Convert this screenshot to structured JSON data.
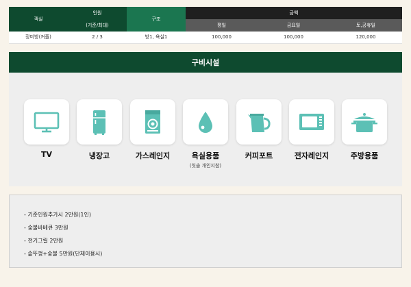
{
  "rate_table": {
    "headers": {
      "room": "객실",
      "capacity": "인원",
      "capacity_sub": "(기준/최대)",
      "structure": "구조",
      "price": "금액",
      "weekday": "평일",
      "friday": "금요일",
      "weekend": "토,공휴일"
    },
    "rows": [
      {
        "room": "장미방(커플)",
        "capacity": "2 / 3",
        "structure": "방1, 욕실1",
        "weekday": "100,000",
        "friday": "100,000",
        "weekend": "120,000"
      }
    ]
  },
  "facilities": {
    "title": "구비시설",
    "items": [
      {
        "label": "TV",
        "sub": "",
        "icon": "tv-icon"
      },
      {
        "label": "냉장고",
        "sub": "",
        "icon": "refrigerator-icon"
      },
      {
        "label": "가스레인지",
        "sub": "",
        "icon": "gas-stove-icon"
      },
      {
        "label": "욕실용품",
        "sub": "(칫솔 개인지참)",
        "icon": "water-drop-icon"
      },
      {
        "label": "커피포트",
        "sub": "",
        "icon": "kettle-icon"
      },
      {
        "label": "전자레인지",
        "sub": "",
        "icon": "microwave-icon"
      },
      {
        "label": "주방용품",
        "sub": "",
        "icon": "pot-icon"
      }
    ],
    "icon_color": "#5cc0b5"
  },
  "notes": [
    "기준인원추가시 2만원(1인)",
    "숯불바베큐 3만원",
    "전기그릴 2만원",
    "솥뚜껑+숯불 5만원(단체이용시)"
  ],
  "colors": {
    "dark_green": "#0e4a2f",
    "mid_green": "#1b7650",
    "black_header": "#1f1f1f",
    "gray_header": "#5a5a5a",
    "page_bg": "#f8f3ea"
  }
}
